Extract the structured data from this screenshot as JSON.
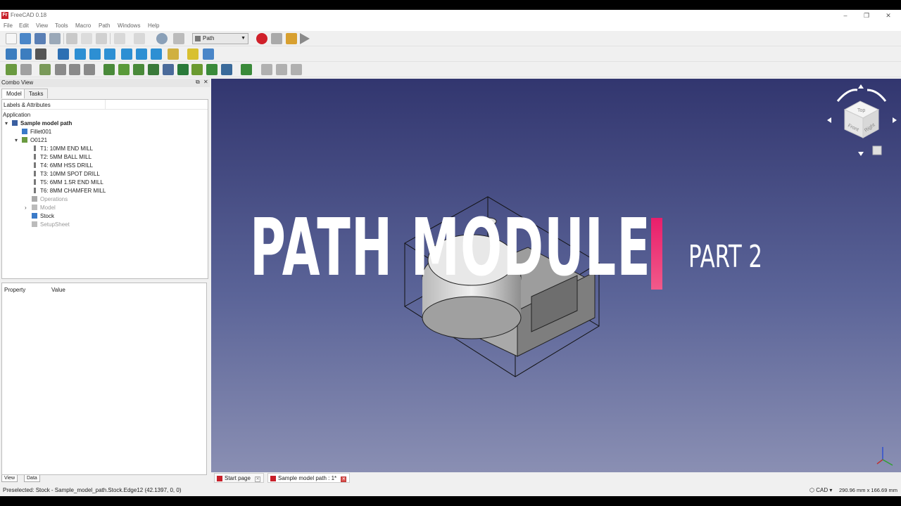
{
  "window": {
    "title": "FreeCAD 0.18",
    "logo_text": "Fr"
  },
  "menu": [
    "File",
    "Edit",
    "View",
    "Tools",
    "Macro",
    "Path",
    "Windows",
    "Help"
  ],
  "toolbar": {
    "workbench": "Path"
  },
  "combo": {
    "title": "Combo View",
    "tabs": [
      "Model",
      "Tasks"
    ],
    "tree_header": "Labels & Attributes",
    "application_label": "Application",
    "tree": [
      {
        "label": "Sample model path",
        "level": 0,
        "icon": "document-icon",
        "style": "bold",
        "expander": "▾"
      },
      {
        "label": "Fillet001",
        "level": 1,
        "icon": "solid-icon",
        "style": "normal",
        "expander": ""
      },
      {
        "label": "O0121",
        "level": 1,
        "icon": "job-icon",
        "style": "normal",
        "expander": "▾"
      },
      {
        "label": "T1: 10MM END MILL",
        "level": 2,
        "icon": "tool-icon",
        "style": "normal",
        "expander": ""
      },
      {
        "label": "T2: 5MM BALL MILL",
        "level": 2,
        "icon": "tool-icon",
        "style": "normal",
        "expander": ""
      },
      {
        "label": "T4: 6MM HSS DRILL",
        "level": 2,
        "icon": "tool-icon",
        "style": "normal",
        "expander": ""
      },
      {
        "label": "T3: 10MM SPOT DRILL",
        "level": 2,
        "icon": "tool-icon",
        "style": "normal",
        "expander": ""
      },
      {
        "label": "T5: 6MM 1.5R END MILL",
        "level": 2,
        "icon": "tool-icon",
        "style": "normal",
        "expander": ""
      },
      {
        "label": "T6: 8MM CHAMFER MILL",
        "level": 2,
        "icon": "tool-icon",
        "style": "normal",
        "expander": ""
      },
      {
        "label": "Operations",
        "level": 2,
        "icon": "operations-icon",
        "style": "grey",
        "expander": ""
      },
      {
        "label": "Model",
        "level": 2,
        "icon": "folder-icon",
        "style": "grey",
        "expander": "›"
      },
      {
        "label": "Stock",
        "level": 2,
        "icon": "stock-icon",
        "style": "normal",
        "expander": ""
      },
      {
        "label": "SetupSheet",
        "level": 2,
        "icon": "sheet-icon",
        "style": "grey",
        "expander": ""
      }
    ],
    "property_header": "Property",
    "value_header": "Value",
    "bottom_tabs": [
      "View",
      "Data"
    ]
  },
  "overlay": {
    "title": "PATH MODULE",
    "subtitle": "PART 2",
    "accent_color": "#e91e6b"
  },
  "navcube": {
    "top": "Top",
    "front": "Front",
    "right": "Right"
  },
  "doc_tabs": [
    {
      "label": "Start page",
      "active": false
    },
    {
      "label": "Sample model path : 1*",
      "active": true
    }
  ],
  "status": {
    "preselected": "Preselected: Stock - Sample_model_path.Stock.Edge12 (42.1397, 0, 0)",
    "nav_style": "CAD",
    "dimensions": "290.96 mm x 166.69 mm"
  }
}
